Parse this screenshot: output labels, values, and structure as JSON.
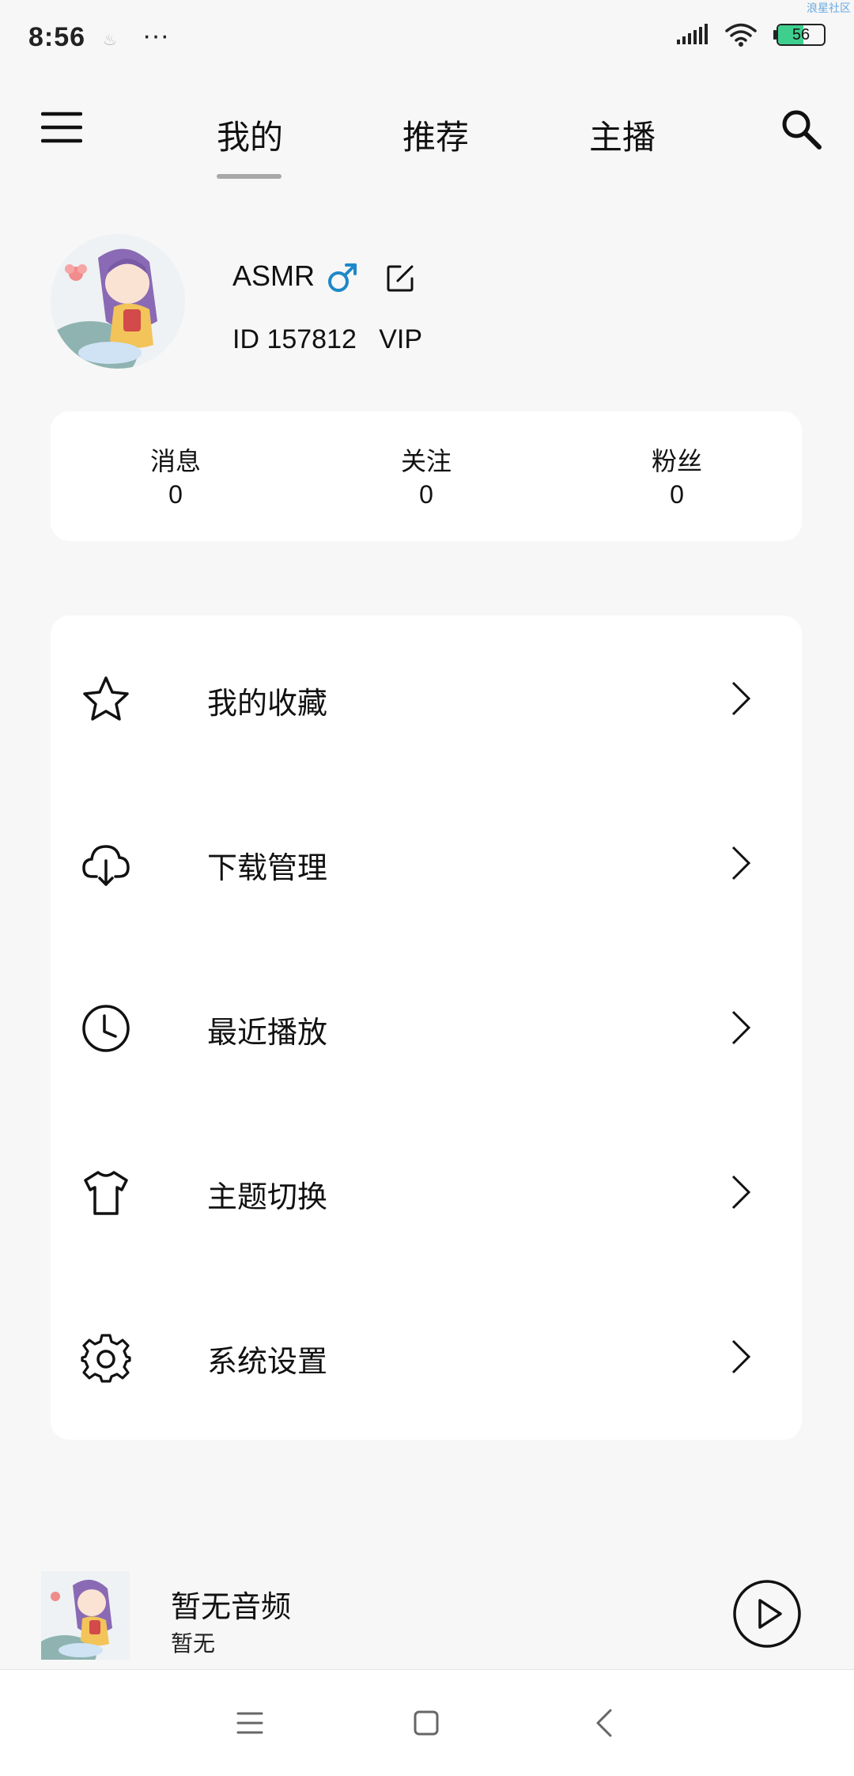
{
  "status_bar": {
    "time": "8:56",
    "extra": "···",
    "small_icon": "♨",
    "battery": "56",
    "battery_fraction": 0.56,
    "watermark": "浪星社区"
  },
  "nav": {
    "tabs": [
      {
        "label": "我的",
        "active": true
      },
      {
        "label": "推荐",
        "active": false
      },
      {
        "label": "主播",
        "active": false
      }
    ],
    "menu_icon": "hamburger-icon",
    "search_icon": "search-icon"
  },
  "profile": {
    "name": "ASMR",
    "gender_icon": "male-icon",
    "gender_color": "#1e88c8",
    "edit_icon": "edit-icon",
    "id_text": "ID 157812",
    "vip_text": "VIP"
  },
  "stats": [
    {
      "label": "消息",
      "value": "0"
    },
    {
      "label": "关注",
      "value": "0"
    },
    {
      "label": "粉丝",
      "value": "0"
    }
  ],
  "menu": [
    {
      "icon": "star-icon",
      "label": "我的收藏"
    },
    {
      "icon": "cloud-download-icon",
      "label": "下载管理"
    },
    {
      "icon": "clock-icon",
      "label": "最近播放"
    },
    {
      "icon": "tshirt-icon",
      "label": "主题切换"
    },
    {
      "icon": "gear-icon",
      "label": "系统设置"
    }
  ],
  "player": {
    "title": "暂无音频",
    "subtitle": "暂无",
    "play_icon": "play-icon"
  },
  "system_nav": {
    "menu_icon": "recent-apps-icon",
    "home_icon": "home-icon",
    "back_icon": "back-icon"
  }
}
